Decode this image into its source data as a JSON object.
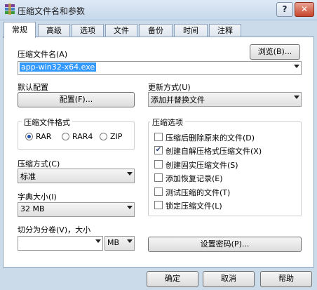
{
  "window": {
    "title": "压缩文件名和参数",
    "help_glyph": "?",
    "close_glyph": "✕"
  },
  "tabs": [
    {
      "label": "常规",
      "active": true
    },
    {
      "label": "高级"
    },
    {
      "label": "选项"
    },
    {
      "label": "文件"
    },
    {
      "label": "备份"
    },
    {
      "label": "时间"
    },
    {
      "label": "注释"
    }
  ],
  "archive": {
    "name_label": "压缩文件名(A)",
    "browse_label": "浏览(B)...",
    "name_value": "app-win32-x64.exe"
  },
  "profile": {
    "label": "默认配置",
    "button": "配置(F)..."
  },
  "update": {
    "label": "更新方式(U)",
    "value": "添加并替换文件"
  },
  "format": {
    "title": "压缩文件格式",
    "options": [
      {
        "label": "RAR",
        "selected": true
      },
      {
        "label": "RAR4",
        "selected": false
      },
      {
        "label": "ZIP",
        "selected": false
      }
    ]
  },
  "method": {
    "label": "压缩方式(C)",
    "value": "标准"
  },
  "dictionary": {
    "label": "字典大小(I)",
    "value": "32 MB"
  },
  "split": {
    "label": "切分为分卷(V)，大小",
    "value": "",
    "unit": "MB"
  },
  "options": {
    "title": "压缩选项",
    "items": [
      {
        "label": "压缩后删除原来的文件(D)",
        "checked": false
      },
      {
        "label": "创建自解压格式压缩文件(X)",
        "checked": true
      },
      {
        "label": "创建固实压缩文件(S)",
        "checked": false
      },
      {
        "label": "添加恢复记录(E)",
        "checked": false
      },
      {
        "label": "测试压缩的文件(T)",
        "checked": false
      },
      {
        "label": "锁定压缩文件(L)",
        "checked": false
      }
    ]
  },
  "password": {
    "button": "设置密码(P)..."
  },
  "footer": {
    "ok": "确定",
    "cancel": "取消",
    "help": "帮助"
  },
  "colors": {
    "selection": "#3399ff",
    "check": "#1f3b6e"
  }
}
